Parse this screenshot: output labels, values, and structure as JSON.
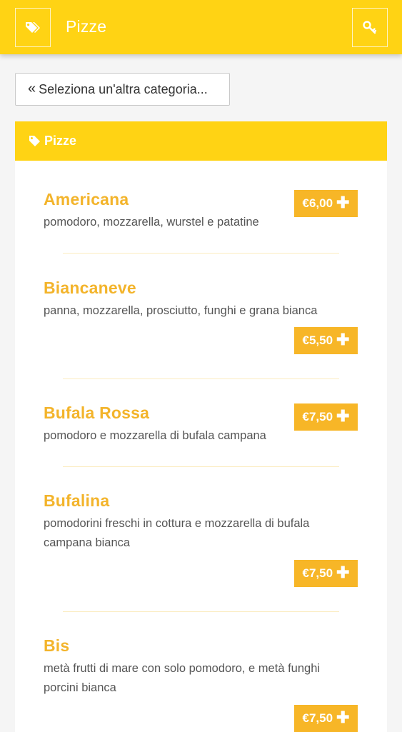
{
  "header": {
    "title": "Pizze",
    "left_icon": "tags-icon",
    "right_icon": "key-icon"
  },
  "back_button": {
    "chevron": "«",
    "label": "Seleziona un'altra categoria..."
  },
  "category": {
    "icon": "tag-icon",
    "title": "Pizze"
  },
  "items": [
    {
      "name": "Americana",
      "description": "pomodoro, mozzarella, wurstel e patatine",
      "price": "€6,00",
      "add": "✚"
    },
    {
      "name": "Biancaneve",
      "description": "panna, mozzarella, prosciutto, funghi e grana bianca",
      "price": "€5,50",
      "add": "✚"
    },
    {
      "name": "Bufala Rossa",
      "description": "pomodoro e mozzarella di bufala campana",
      "price": "€7,50",
      "add": "✚"
    },
    {
      "name": "Bufalina",
      "description": "pomodorini freschi in cottura e mozzarella di bufala campana bianca",
      "price": "€7,50",
      "add": "✚"
    },
    {
      "name": "Bis",
      "description": "metà frutti di mare con solo pomodoro, e metà funghi porcini bianca",
      "price": "€7,50",
      "add": "✚"
    }
  ],
  "colors": {
    "brand_yellow": "#ffd314",
    "accent_orange": "#f7b627",
    "item_title": "#f3b42b"
  }
}
